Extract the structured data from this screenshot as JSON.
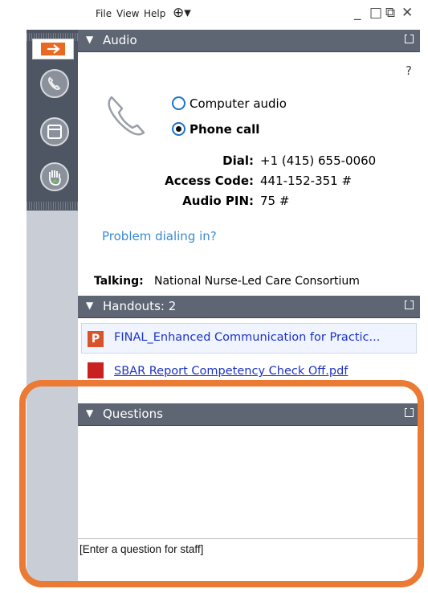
{
  "menu": {
    "file": "File",
    "view": "View",
    "help": "Help"
  },
  "window_controls": {
    "minimize": "_",
    "restore": "□",
    "popout": "⧉",
    "close": "✕"
  },
  "audio": {
    "header": "Audio",
    "help": "?",
    "option_computer": "Computer audio",
    "option_phone": "Phone call",
    "selected": "Phone call",
    "dial_label": "Dial:",
    "dial_value": "+1 (415) 655-0060",
    "access_label": "Access Code:",
    "access_value": "441-152-351 #",
    "pin_label": "Audio PIN:",
    "pin_value": "75 #",
    "problem_link": "Problem dialing in?",
    "talking_label": "Talking:",
    "talking_value": "National Nurse-Led Care Consortium"
  },
  "handouts": {
    "header": "Handouts: 2",
    "items": [
      {
        "icon": "P",
        "name": "FINAL_Enhanced Communication for Practic..."
      },
      {
        "icon": "pdf",
        "name": "SBAR Report Competency Check Off.pdf"
      }
    ]
  },
  "questions": {
    "header": "Questions",
    "input_placeholder": "[Enter a question for staff]"
  },
  "colors": {
    "header_bg": "#5e6573",
    "highlight": "#ea7a34",
    "link": "#1c32c9",
    "accent": "#e8691f"
  }
}
